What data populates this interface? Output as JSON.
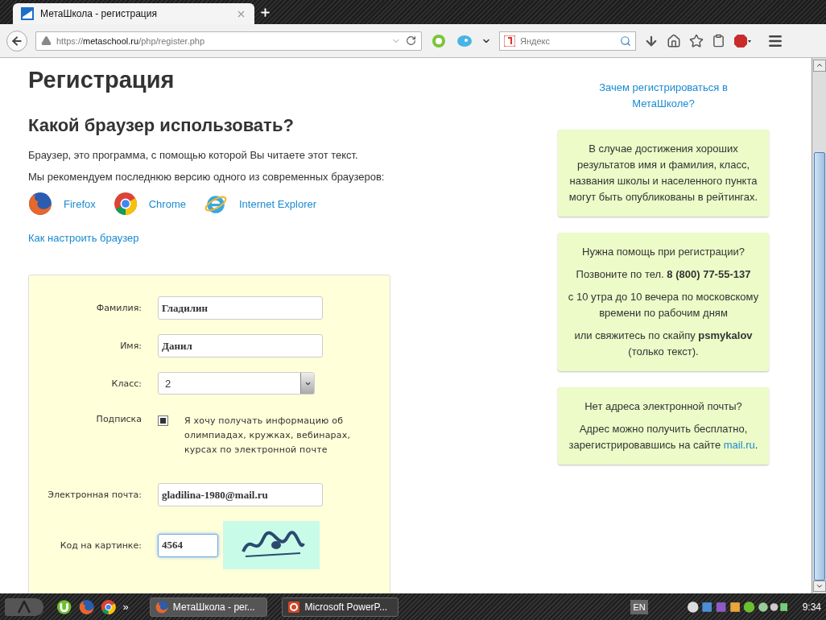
{
  "browser": {
    "tab": {
      "title": "МетаШкола - регистрация",
      "selected": true
    },
    "url": {
      "scheme": "https://",
      "host": "metaschool.ru",
      "path": "/php/register.php"
    },
    "search": {
      "placeholder": "Яндекс"
    }
  },
  "page": {
    "title": "Регистрация",
    "subtitle": "Какой браузер использовать?",
    "paragraphs": [
      "Браузер, это программа, с помощью которой Вы читаете этот текст.",
      "Мы рекомендуем последнюю версию одного из современных браузеров:"
    ],
    "browsers": [
      {
        "kind": "firefox",
        "label": "Firefox"
      },
      {
        "kind": "chrome",
        "label": "Chrome"
      },
      {
        "kind": "ie",
        "label": "Internet Explorer"
      }
    ],
    "setup_link": "Как настроить браузер"
  },
  "form": {
    "fields": [
      {
        "kind": "text",
        "label": "Фамилия:",
        "value": "Гладилин"
      },
      {
        "kind": "text",
        "label": "Имя:",
        "value": "Данил"
      },
      {
        "kind": "select",
        "label": "Класс:",
        "value": "2"
      },
      {
        "kind": "checkbox",
        "label": "Подписка",
        "text": "Я хочу получать информацию об олимпиадах, кружках, вебинарах, курсах по электронной почте",
        "checked": true
      },
      {
        "kind": "text",
        "label": "Электронная почта:",
        "value": "gladilina-1980@mail.ru"
      },
      {
        "kind": "captcha",
        "label": "Код на картинке:",
        "value": "4564",
        "focused": true
      }
    ]
  },
  "sidebar": {
    "link": "Зачем регистрироваться в МетаШколе?",
    "cards": [
      {
        "paragraphs": [
          {
            "text": "В случае достижения хороших результатов имя и фамилия, класс, названия школы и населенного пункта могут быть опубликованы в рейтингах."
          }
        ]
      },
      {
        "paragraphs": [
          {
            "text": "Нужна помощь при регистрации?"
          },
          {
            "text": "Позвоните по тел. **8 (800) 77-55-137**"
          },
          {
            "text": "с 10 утра до 10 вечера по московскому времени по рабочим дням"
          },
          {
            "text": "или свяжитесь по скайпу **psmykalov** (только текст)."
          }
        ]
      },
      {
        "paragraphs": [
          {
            "text": "Нет адреса электронной почты?"
          },
          {
            "text": "Адрес можно получить бесплатно, зарегистрировавшись на сайте",
            "link": "mail.ru",
            "after": "."
          }
        ]
      }
    ]
  },
  "taskbar": {
    "more": "»",
    "tasks": [
      {
        "kind": "firefox",
        "label": "МетаШкола - рег...",
        "selected": true
      },
      {
        "kind": "powerpoint",
        "label": "Microsoft PowerP...",
        "selected": false
      }
    ],
    "language": "EN",
    "clock": "9:34"
  }
}
